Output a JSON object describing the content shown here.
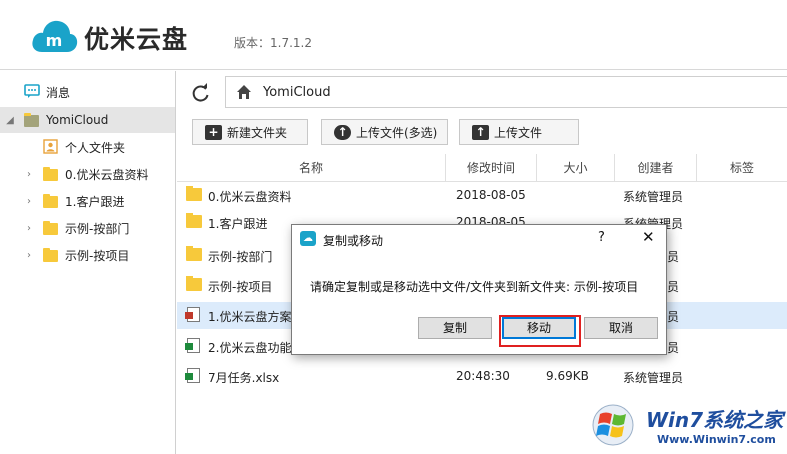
{
  "header": {
    "app_name": "优米云盘",
    "logo_mark": "m",
    "version": "版本：1.7.1.2"
  },
  "sidebar": {
    "messages": "消息",
    "root": "YomiCloud",
    "items": [
      {
        "label": "个人文件夹"
      },
      {
        "label": "0.优米云盘资料"
      },
      {
        "label": "1.客户跟进"
      },
      {
        "label": "示例-按部门"
      },
      {
        "label": "示例-按项目"
      }
    ]
  },
  "path": {
    "current": "YomiCloud"
  },
  "toolbar": {
    "new_folder": "新建文件夹",
    "upload_multi": "上传文件(多选)",
    "upload_file": "上传文件"
  },
  "table": {
    "columns": [
      "名称",
      "修改时间",
      "大小",
      "创建者",
      "标签"
    ],
    "rows": [
      {
        "name": "0.优米云盘资料",
        "date": "2018-08-05",
        "size": "",
        "owner": "系统管理员",
        "type": "folder"
      },
      {
        "name": "1.客户跟进",
        "date": "2018-08-05",
        "size": "",
        "owner": "系统管理员",
        "type": "folder"
      },
      {
        "name": "示例-按部门",
        "date": "",
        "size": "",
        "owner": "员",
        "type": "folder"
      },
      {
        "name": "示例-按项目",
        "date": "",
        "size": "",
        "owner": "员",
        "type": "folder"
      },
      {
        "name": "1.优米云盘方案",
        "date": "",
        "size": "",
        "owner": "员",
        "type": "doc"
      },
      {
        "name": "2.优米云盘功能",
        "date": "",
        "size": "",
        "owner": "员",
        "type": "xls"
      },
      {
        "name": "7月任务.xlsx",
        "date": "20:48:30",
        "size": "9.69KB",
        "owner": "系统管理员",
        "type": "xls"
      }
    ]
  },
  "dialog": {
    "title": "复制或移动",
    "help": "?",
    "close": "✕",
    "message": "请确定复制或是移动选中文件/文件夹到新文件夹: 示例-按项目",
    "copy_label": "复制",
    "move_label": "移动",
    "cancel_label": "取消"
  },
  "watermark": {
    "title": "Win7系统之家",
    "url": "Www.Winwin7.com"
  },
  "colors": {
    "brand": "#1aa3c9",
    "selected_row": "#dcebfb",
    "folder": "#f7c93b",
    "highlight": "#e02020"
  }
}
